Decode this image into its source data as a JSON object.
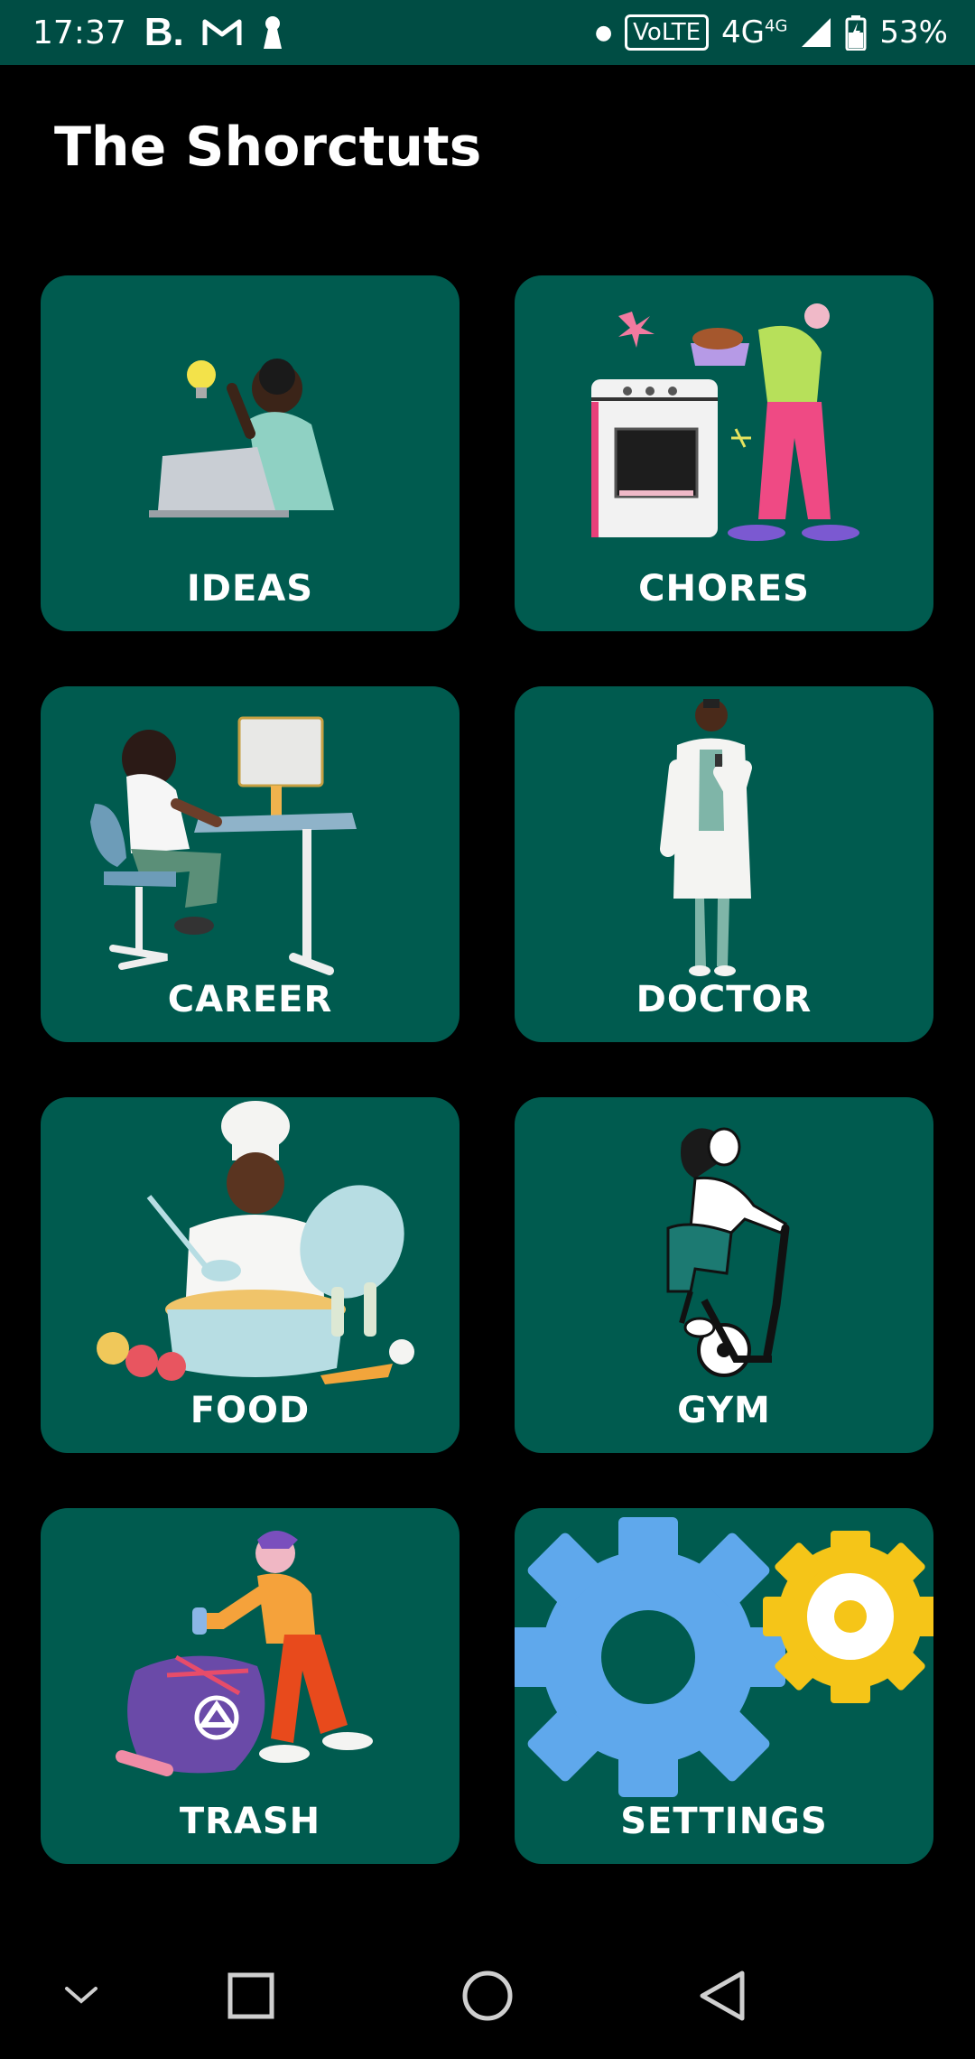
{
  "status_bar": {
    "time": "17:37",
    "carrier_badge": "B.",
    "network_badge": "VoLTE",
    "network_type": "4G",
    "network_sup": "4G",
    "battery": "53%"
  },
  "app": {
    "title": "The Shorctuts"
  },
  "tiles": [
    {
      "label": "IDEAS",
      "icon": "person-laptop-lightbulb-illustration"
    },
    {
      "label": "CHORES",
      "icon": "person-oven-cooking-illustration"
    },
    {
      "label": "CAREER",
      "icon": "person-desk-computer-illustration"
    },
    {
      "label": "DOCTOR",
      "icon": "doctor-illustration"
    },
    {
      "label": "FOOD",
      "icon": "chef-pot-illustration"
    },
    {
      "label": "GYM",
      "icon": "person-exercise-bike-illustration"
    },
    {
      "label": "TRASH",
      "icon": "person-trash-bag-illustration"
    },
    {
      "label": "SETTINGS",
      "icon": "gears-icon"
    }
  ],
  "nav_bar": {
    "buttons": [
      "collapse-icon",
      "recents-icon",
      "home-icon",
      "back-icon"
    ]
  },
  "colors": {
    "status_bar": "#004d44",
    "tile_background": "#005b4f",
    "page_background": "#000000",
    "gear_blue": "#5fa8ec",
    "gear_yellow": "#f5c518"
  }
}
